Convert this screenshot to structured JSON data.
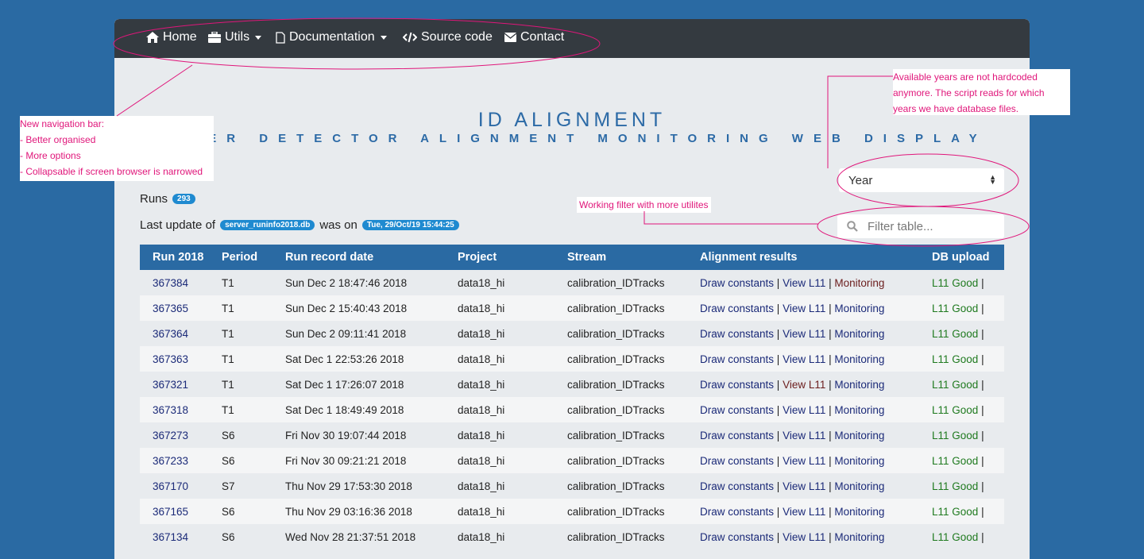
{
  "nav": {
    "home": "Home",
    "utils": "Utils",
    "documentation": "Documentation",
    "source_code": "Source code",
    "contact": "Contact"
  },
  "header": {
    "title": "ID ALIGNMENT",
    "subtitle": "INNER DETECTOR ALIGNMENT MONITORING WEB DISPLAY"
  },
  "year_select": {
    "value": "Year"
  },
  "filter": {
    "placeholder": "Filter table..."
  },
  "runs": {
    "label": "Runs",
    "count": "293"
  },
  "last_update": {
    "prefix": "Last update of",
    "file": "server_runinfo2018.db",
    "middle": "was on",
    "date": "Tue, 29/Oct/19 15:44:25"
  },
  "table": {
    "columns": [
      "Run 2018",
      "Period",
      "Run record date",
      "Project",
      "Stream",
      "Alignment results",
      "DB upload"
    ],
    "action_labels": {
      "draw": "Draw constants",
      "view": "View L11",
      "monitoring": "Monitoring",
      "good": "L11 Good"
    },
    "rows": [
      {
        "run": "367384",
        "period": "T1",
        "date": "Sun Dec 2 18:47:46 2018",
        "project": "data18_hi",
        "stream": "calibration_IDTracks",
        "view_visited": false,
        "mon_visited": true
      },
      {
        "run": "367365",
        "period": "T1",
        "date": "Sun Dec 2 15:40:43 2018",
        "project": "data18_hi",
        "stream": "calibration_IDTracks",
        "view_visited": false,
        "mon_visited": false
      },
      {
        "run": "367364",
        "period": "T1",
        "date": "Sun Dec 2 09:11:41 2018",
        "project": "data18_hi",
        "stream": "calibration_IDTracks",
        "view_visited": false,
        "mon_visited": false
      },
      {
        "run": "367363",
        "period": "T1",
        "date": "Sat Dec 1 22:53:26 2018",
        "project": "data18_hi",
        "stream": "calibration_IDTracks",
        "view_visited": false,
        "mon_visited": false
      },
      {
        "run": "367321",
        "period": "T1",
        "date": "Sat Dec 1 17:26:07 2018",
        "project": "data18_hi",
        "stream": "calibration_IDTracks",
        "view_visited": true,
        "mon_visited": false
      },
      {
        "run": "367318",
        "period": "T1",
        "date": "Sat Dec 1 18:49:49 2018",
        "project": "data18_hi",
        "stream": "calibration_IDTracks",
        "view_visited": false,
        "mon_visited": false
      },
      {
        "run": "367273",
        "period": "S6",
        "date": "Fri Nov 30 19:07:44 2018",
        "project": "data18_hi",
        "stream": "calibration_IDTracks",
        "view_visited": false,
        "mon_visited": false
      },
      {
        "run": "367233",
        "period": "S6",
        "date": "Fri Nov 30 09:21:21 2018",
        "project": "data18_hi",
        "stream": "calibration_IDTracks",
        "view_visited": false,
        "mon_visited": false
      },
      {
        "run": "367170",
        "period": "S7",
        "date": "Thu Nov 29 17:53:30 2018",
        "project": "data18_hi",
        "stream": "calibration_IDTracks",
        "view_visited": false,
        "mon_visited": false
      },
      {
        "run": "367165",
        "period": "S6",
        "date": "Thu Nov 29 03:16:36 2018",
        "project": "data18_hi",
        "stream": "calibration_IDTracks",
        "view_visited": false,
        "mon_visited": false
      },
      {
        "run": "367134",
        "period": "S6",
        "date": "Wed Nov 28 21:37:51 2018",
        "project": "data18_hi",
        "stream": "calibration_IDTracks",
        "view_visited": false,
        "mon_visited": false
      }
    ]
  },
  "annotations": {
    "navbar_note": [
      "New navigation bar:",
      "-  Better organised",
      "-  More options",
      "-  Collapsable if screen browser is narrowed"
    ],
    "years_note": [
      "Available years are not hardcoded",
      "anymore. The script reads for which",
      "years we have database files."
    ],
    "filter_note": "Working filter with more utilites",
    "color": "#e0167a"
  },
  "colors": {
    "page_bg": "#2a6aa3",
    "navbar": "#343a40",
    "table_header": "#2a6aa3",
    "title": "#2c6aa6",
    "badge": "#1f8ad0"
  }
}
